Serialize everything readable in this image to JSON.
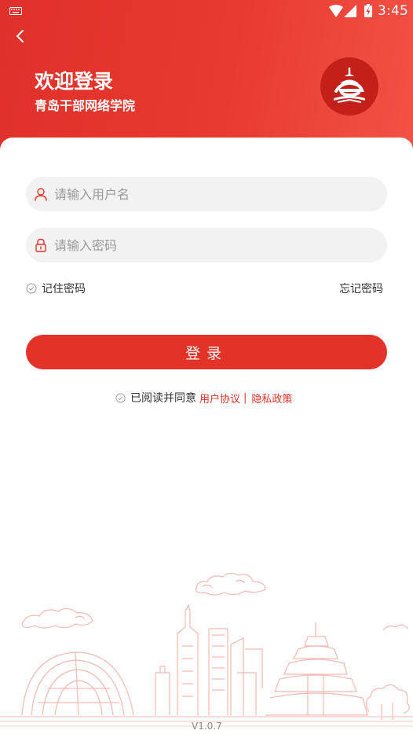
{
  "status_bar": {
    "time": "3:45"
  },
  "header": {
    "title": "欢迎登录",
    "subtitle": "青岛干部网络学院"
  },
  "form": {
    "username_placeholder": "请输入用户名",
    "password_placeholder": "请输入密码",
    "remember_label": "记住密码",
    "forgot_label": "忘记密码",
    "login_label": "登录"
  },
  "agreement": {
    "prefix": "已阅读并同意",
    "user_agreement": "用户协议",
    "separator": "|",
    "privacy_policy": "隐私政策"
  },
  "footer": {
    "version": "V1.0.7"
  },
  "colors": {
    "primary": "#e33328",
    "header_end": "#f25245",
    "logo_bg": "#c4201a"
  }
}
